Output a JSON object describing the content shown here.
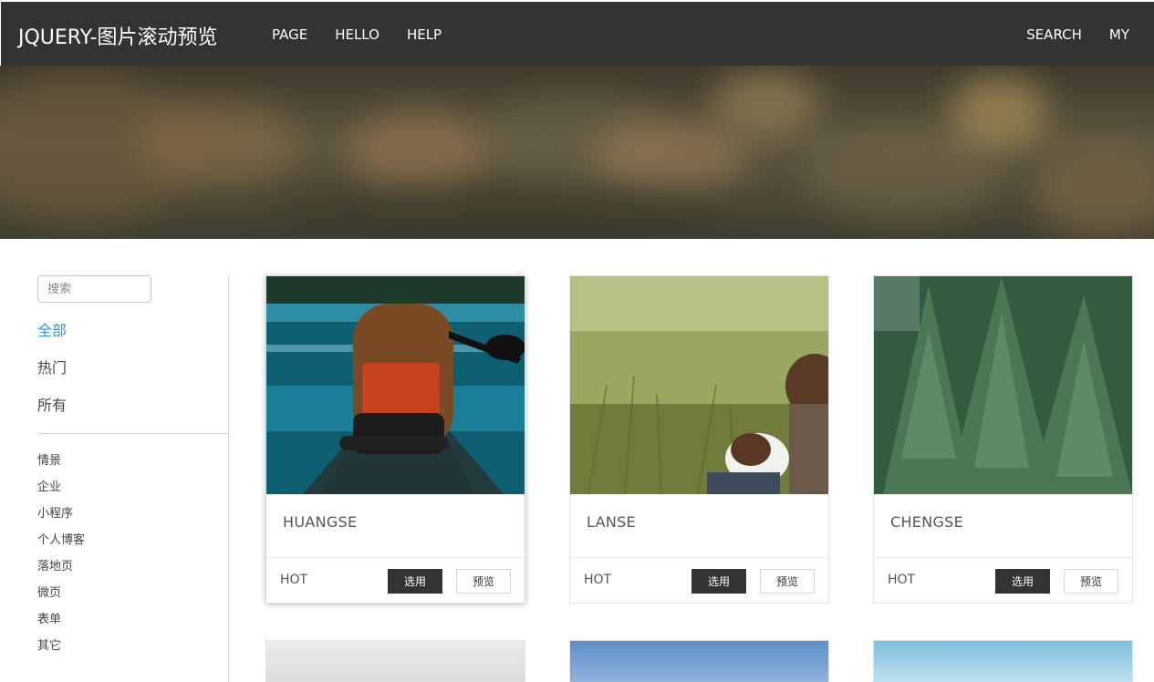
{
  "header": {
    "brand": "JQUERY-图片滚动预览",
    "nav_left": [
      "PAGE",
      "HELLO",
      "HELP"
    ],
    "nav_right": [
      "SEARCH",
      "MY"
    ]
  },
  "sidebar": {
    "search_placeholder": "搜索",
    "main_categories": [
      {
        "label": "全部",
        "active": true
      },
      {
        "label": "热门",
        "active": false
      },
      {
        "label": "所有",
        "active": false
      }
    ],
    "sub_categories": [
      "情景",
      "企业",
      "小程序",
      "个人博客",
      "落地页",
      "微页",
      "表单",
      "其它"
    ]
  },
  "cards": [
    {
      "title": "HUANGSE",
      "tag": "HOT",
      "choose_label": "选用",
      "preview_label": "预览"
    },
    {
      "title": "LANSE",
      "tag": "HOT",
      "choose_label": "选用",
      "preview_label": "预览"
    },
    {
      "title": "CHENGSE",
      "tag": "HOT",
      "choose_label": "选用",
      "preview_label": "预览"
    }
  ],
  "colors": {
    "navbar": "#333333",
    "accent": "#2d96d6",
    "button_dark": "#333333"
  }
}
